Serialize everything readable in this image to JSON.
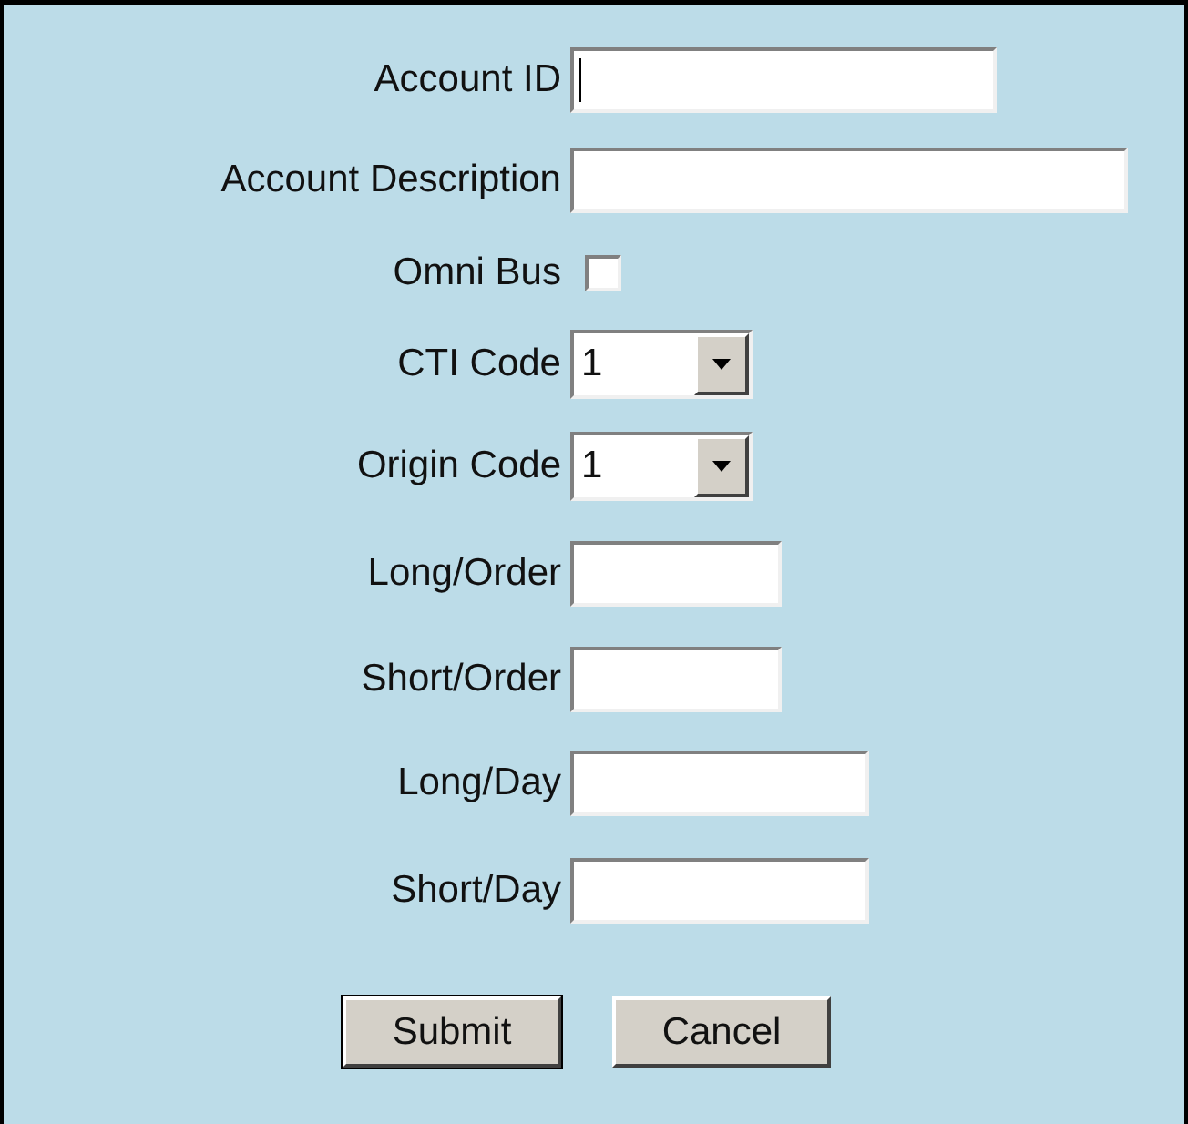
{
  "fields": [
    {
      "kind": "text",
      "label": "Account ID",
      "focused": true
    },
    {
      "kind": "text",
      "label": "Account Description",
      "focused": false
    },
    {
      "kind": "checkbox",
      "label": "Omni Bus",
      "checked": false
    },
    {
      "kind": "select",
      "label": "CTI Code",
      "value": "1"
    },
    {
      "kind": "select",
      "label": "Origin Code",
      "value": "1"
    },
    {
      "kind": "text",
      "label": "Long/Order",
      "focused": false
    },
    {
      "kind": "text",
      "label": "Short/Order",
      "focused": false
    },
    {
      "kind": "text",
      "label": "Long/Day",
      "focused": false
    },
    {
      "kind": "text",
      "label": "Short/Day",
      "focused": false
    }
  ],
  "buttons": [
    {
      "label": "Submit",
      "default": true
    },
    {
      "label": "Cancel",
      "default": false
    }
  ]
}
